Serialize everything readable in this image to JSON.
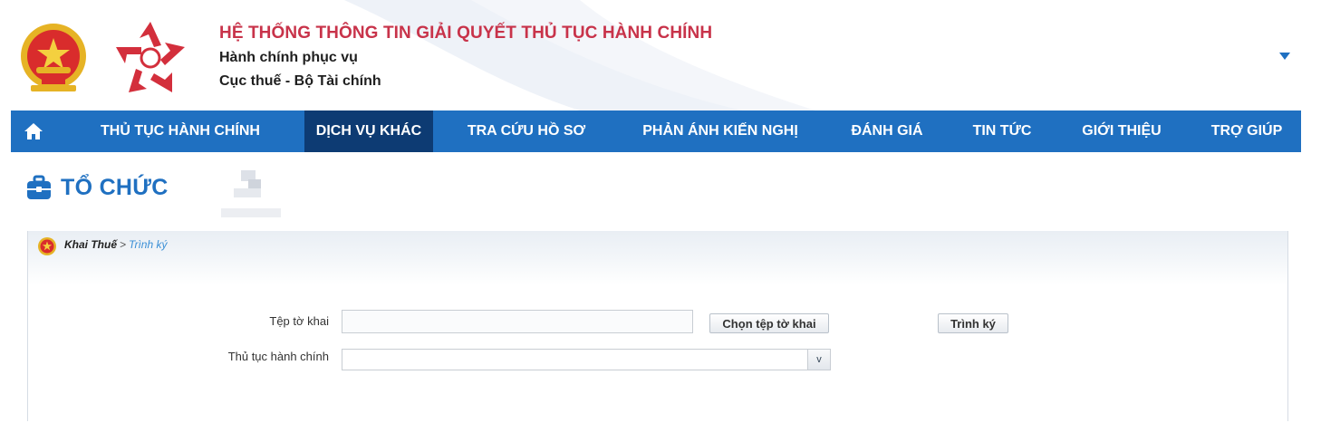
{
  "header": {
    "system_title": "HỆ THỐNG THÔNG TIN GIẢI QUYẾT THỦ TỤC HÀNH CHÍNH",
    "subtitle_line1": "Hành chính phục vụ",
    "subtitle_line2": "Cục thuế - Bộ Tài chính",
    "account_menu_icon": "caret-down-icon"
  },
  "nav": {
    "home_icon": "home-icon",
    "items": [
      {
        "label": "THỦ TỤC HÀNH CHÍNH",
        "active": false
      },
      {
        "label": "DỊCH VỤ KHÁC",
        "active": true
      },
      {
        "label": "TRA CỨU HỒ SƠ",
        "active": false
      },
      {
        "label": "PHẢN ÁNH KIẾN NGHỊ",
        "active": false
      },
      {
        "label": "ĐÁNH GIÁ",
        "active": false
      },
      {
        "label": "TIN TỨC",
        "active": false
      },
      {
        "label": "GIỚI THIỆU",
        "active": false
      },
      {
        "label": "TRỢ GIÚP",
        "active": false
      }
    ]
  },
  "page": {
    "title": "TỔ CHỨC",
    "title_icon": "briefcase-icon"
  },
  "breadcrumb": {
    "parent": "Khai Thuế",
    "separator": ">",
    "current": "Trình ký"
  },
  "form": {
    "file_label": "Tệp tờ khai",
    "file_value": "",
    "choose_file_button": "Chọn tệp tờ khai",
    "sign_button": "Trình ký",
    "procedure_label": "Thủ tục hành chính",
    "procedure_value": "",
    "dropdown_arrow": "v"
  },
  "colors": {
    "brand_blue": "#1f70c1",
    "nav_active": "#0d3b73",
    "title_red": "#c8334a"
  }
}
